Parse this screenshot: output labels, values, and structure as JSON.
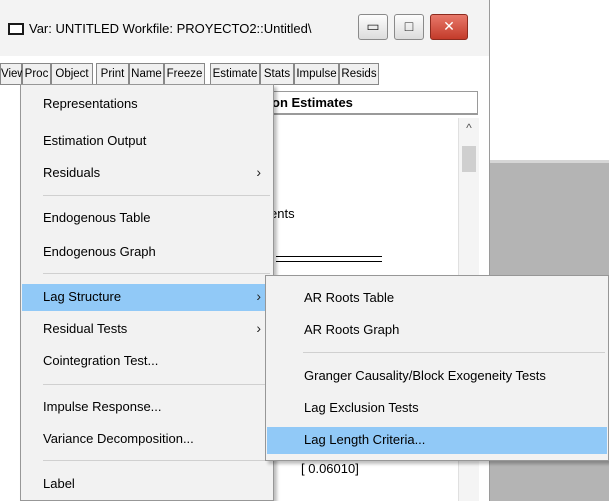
{
  "window": {
    "title": "Var: UNTITLED   Workfile: PROYECTO2::Untitled\\",
    "controls": {
      "minimize": "▭",
      "maximize": "□",
      "close": "✕"
    }
  },
  "toolbar": {
    "buttons": [
      "View",
      "Proc",
      "Object",
      "Print",
      "Name",
      "Freeze",
      "Estimate",
      "Stats",
      "Impulse",
      "Resids"
    ]
  },
  "content": {
    "header": "on Estimates",
    "fragment_ents": "ents",
    "fragment_value": "[ 0.06010]"
  },
  "view_menu": {
    "items": [
      {
        "label": "Representations",
        "submenu": false
      },
      {
        "label": "Estimation Output",
        "submenu": false
      },
      {
        "label": "Residuals",
        "submenu": true
      },
      {
        "label": "Endogenous Table",
        "submenu": false
      },
      {
        "label": "Endogenous Graph",
        "submenu": false
      },
      {
        "label": "Lag Structure",
        "submenu": true,
        "active": true
      },
      {
        "label": "Residual Tests",
        "submenu": true
      },
      {
        "label": "Cointegration Test...",
        "submenu": false
      },
      {
        "label": "Impulse Response...",
        "submenu": false
      },
      {
        "label": "Variance Decomposition...",
        "submenu": false
      },
      {
        "label": "Label",
        "submenu": false
      }
    ],
    "submenu_arrow": "›"
  },
  "lag_structure_menu": {
    "items": [
      {
        "label": "AR Roots Table"
      },
      {
        "label": "AR Roots Graph"
      },
      {
        "label": "Granger Causality/Block Exogeneity Tests"
      },
      {
        "label": "Lag Exclusion Tests"
      },
      {
        "label": "Lag Length Criteria...",
        "active": true
      }
    ]
  },
  "colors": {
    "highlight": "#91c9f7",
    "menu_bg": "#f2f2f2",
    "close_button": "#c33b2a"
  }
}
